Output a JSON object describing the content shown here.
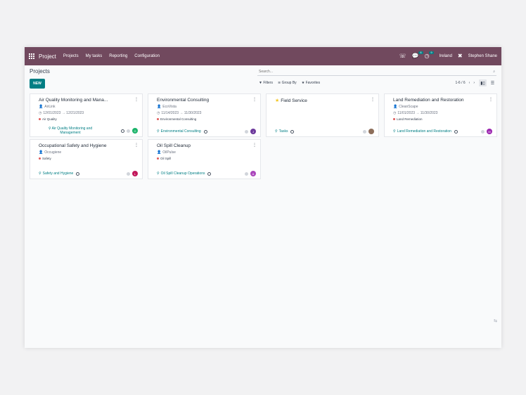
{
  "navbar": {
    "brand": "Project",
    "menu": [
      "Projects",
      "My tasks",
      "Reporting",
      "Configuration"
    ],
    "chat_badge": "6",
    "activity_badge": "9",
    "company": "Ireland",
    "user": "Stephen Shane"
  },
  "control": {
    "title": "Projects",
    "new_label": "NEW",
    "search_placeholder": "Search...",
    "filters_label": "Filters",
    "groupby_label": "Group By",
    "favorites_label": "Favorites",
    "pager": "1-6 / 6"
  },
  "cards": [
    {
      "title": "Air Quality Monitoring and Mana...",
      "customer": "AirLink",
      "dates": "12/01/2023 → 12/21/2023",
      "tag": "Air Quality",
      "tag_color": "#e05a5a",
      "task_label": "Air Quality Monitoring and Management",
      "avatar": "G",
      "avatar_color": "#1bb36a",
      "favorite": false
    },
    {
      "title": "Environmental Consulting",
      "customer": "EcoVista",
      "dates": "11/14/2023 → 11/30/2023",
      "tag": "Environmental Consulting",
      "tag_color": "#e05a5a",
      "task_label": "Environmental Consulting",
      "avatar": "J",
      "avatar_color": "#6d3a9c",
      "favorite": false
    },
    {
      "title": "Field Service",
      "customer": "",
      "dates": "",
      "tag": "",
      "tag_color": "",
      "task_label": "Tasks",
      "avatar": "",
      "avatar_color": "#8d6e5a",
      "favorite": true
    },
    {
      "title": "Land Remediation and Restoration",
      "customer": "CleanScape",
      "dates": "11/01/2023 → 11/30/2023",
      "tag": "Land Remediation",
      "tag_color": "#e05a5a",
      "task_label": "Land Remediation and Restoration",
      "avatar": "M",
      "avatar_color": "#9c27b0",
      "favorite": false
    },
    {
      "title": "Occupational Safety and Hygiene",
      "customer": "Occugiene",
      "dates": "",
      "tag": "Safety",
      "tag_color": "#e05a5a",
      "task_label": "Safety and Hygiene",
      "avatar": "L",
      "avatar_color": "#c2185b",
      "favorite": false
    },
    {
      "title": "Oil Spill Cleanup",
      "customer": "OilPulse",
      "dates": "",
      "tag": "Oil Spill",
      "tag_color": "#e05a5a",
      "task_label": "Oil Spill Cleanup Operations",
      "avatar": "A",
      "avatar_color": "#ab47bc",
      "favorite": false
    }
  ]
}
